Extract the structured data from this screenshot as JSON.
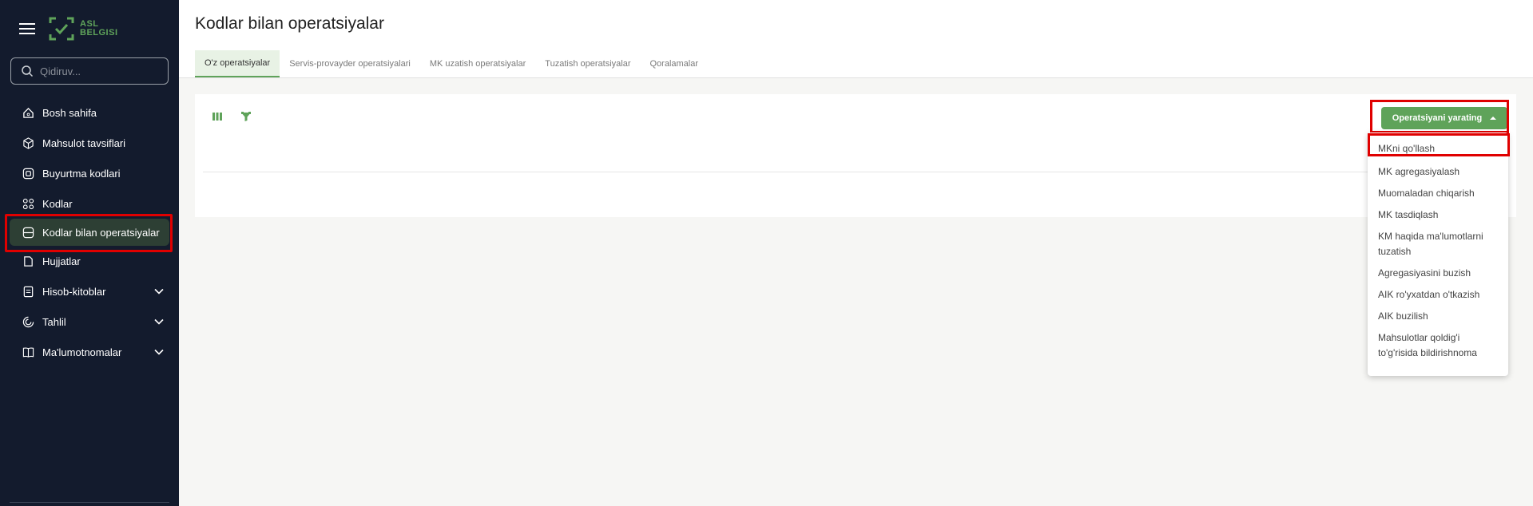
{
  "brand": {
    "line1": "ASL",
    "line2": "BELGISI"
  },
  "search": {
    "placeholder": "Qidiruv..."
  },
  "sidebar": {
    "items": [
      {
        "label": "Bosh sahifa",
        "icon": "home-icon"
      },
      {
        "label": "Mahsulot tavsiflari",
        "icon": "cube-icon"
      },
      {
        "label": "Buyurtma kodlari",
        "icon": "qrcode-icon"
      },
      {
        "label": "Kodlar",
        "icon": "codes-icon"
      },
      {
        "label": "Kodlar bilan operatsiyalar",
        "icon": "operations-icon",
        "active": true
      },
      {
        "label": "Hujjatlar",
        "icon": "document-icon"
      },
      {
        "label": "Hisob-kitoblar",
        "icon": "report-icon",
        "expandable": true
      },
      {
        "label": "Tahlil",
        "icon": "chart-icon",
        "expandable": true
      },
      {
        "label": "Ma'lumotnomalar",
        "icon": "book-icon",
        "expandable": true
      }
    ]
  },
  "header": {
    "title": "Kodlar bilan operatsiyalar",
    "tabs": [
      {
        "label": "O'z operatsiyalar",
        "active": true
      },
      {
        "label": "Servis-provayder operatsiyalari"
      },
      {
        "label": "MK uzatish operatsiyalar"
      },
      {
        "label": "Tuzatish operatsiyalar"
      },
      {
        "label": "Qoralamalar"
      }
    ]
  },
  "toolbar": {
    "create_label": "Operatsiyani yarating"
  },
  "dropdown": {
    "items": [
      "MKni qo'llash",
      "MK agregasiyalash",
      "Muomaladan chiqarish",
      "MK tasdiqlash",
      "KM haqida ma'lumotlarni tuzatish",
      "Agregasiyasini buzish",
      "AIK ro'yxatdan o'tkazish",
      "AIK buzilish",
      "Mahsulotlar qoldig'i to'g'risida bildirishnoma"
    ]
  },
  "colors": {
    "accent": "#5fa35a",
    "sidebar": "#131b2d",
    "highlight": "#e00000"
  }
}
